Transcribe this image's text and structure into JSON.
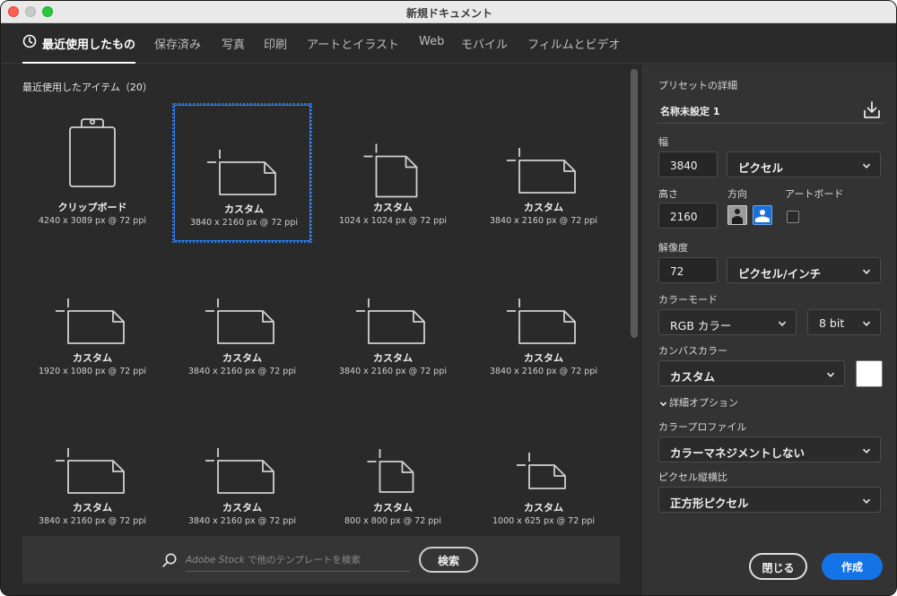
{
  "window": {
    "title": "新規ドキュメント"
  },
  "tabs": [
    {
      "label": "最近使用したもの",
      "active": true
    },
    {
      "label": "保存済み"
    },
    {
      "label": "写真"
    },
    {
      "label": "印刷"
    },
    {
      "label": "アートとイラスト"
    },
    {
      "label": "Web"
    },
    {
      "label": "モバイル"
    },
    {
      "label": "フィルムとビデオ"
    }
  ],
  "recent": {
    "heading": "最近使用したアイテム（20）",
    "items": [
      {
        "name": "クリップボード",
        "size": "4240 x 3089 px @ 72 ppi",
        "icon": "clipboard-icon"
      },
      {
        "name": "カスタム",
        "size": "3840 x 2160 px @ 72 ppi",
        "icon": "document-icon",
        "selected": true
      },
      {
        "name": "カスタム",
        "size": "1024 x 1024 px @ 72 ppi",
        "icon": "document-icon"
      },
      {
        "name": "カスタム",
        "size": "3840 x 2160 px @ 72 ppi",
        "icon": "document-icon"
      },
      {
        "name": "カスタム",
        "size": "1920 x 1080 px @ 72 ppi",
        "icon": "document-icon"
      },
      {
        "name": "カスタム",
        "size": "3840 x 2160 px @ 72 ppi",
        "icon": "document-icon"
      },
      {
        "name": "カスタム",
        "size": "3840 x 2160 px @ 72 ppi",
        "icon": "document-icon"
      },
      {
        "name": "カスタム",
        "size": "3840 x 2160 px @ 72 ppi",
        "icon": "document-icon"
      },
      {
        "name": "カスタム",
        "size": "3840 x 2160 px @ 72 ppi",
        "icon": "document-icon"
      },
      {
        "name": "カスタム",
        "size": "3840 x 2160 px @ 72 ppi",
        "icon": "document-icon"
      },
      {
        "name": "カスタム",
        "size": "800 x 800 px @ 72 ppi",
        "icon": "document-icon"
      },
      {
        "name": "カスタム",
        "size": "1000 x 625 px @ 72 ppi",
        "icon": "document-icon"
      }
    ]
  },
  "search": {
    "brand": "Adobe Stock",
    "placeholder_rest": " で他のテンプレートを検索",
    "button_label": "検索"
  },
  "preset": {
    "heading": "プリセットの詳細",
    "name": "名称未設定 1",
    "width_label": "幅",
    "width_value": "3840",
    "width_unit": "ピクセル",
    "height_label": "高さ",
    "height_value": "2160",
    "orientation_label": "方向",
    "artboard_label": "アートボード",
    "artboard_checked": false,
    "resolution_label": "解像度",
    "resolution_value": "72",
    "resolution_unit": "ピクセル/インチ",
    "color_mode_label": "カラーモード",
    "color_mode": "RGB カラー",
    "bit_depth": "8 bit",
    "canvas_color_label": "カンバスカラー",
    "canvas_color": "カスタム",
    "canvas_swatch": "#ffffff",
    "advanced_label": "詳細オプション",
    "color_profile_label": "カラープロファイル",
    "color_profile": "カラーマネジメントしない",
    "pixel_aspect_label": "ピクセル縦横比",
    "pixel_aspect": "正方形ピクセル"
  },
  "actions": {
    "close_label": "閉じる",
    "create_label": "作成"
  },
  "colors": {
    "accent": "#1473e6",
    "selection": "#2b7de9"
  }
}
